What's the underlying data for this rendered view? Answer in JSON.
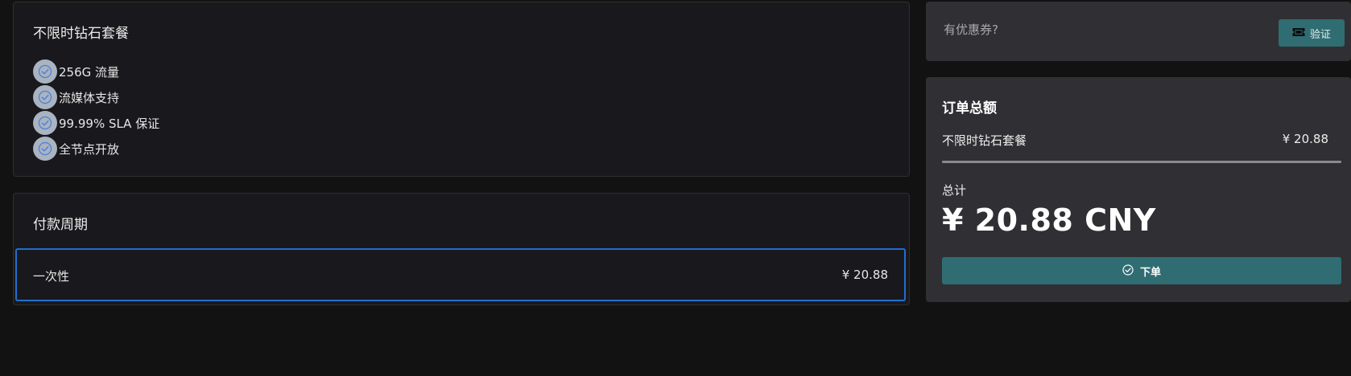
{
  "plan": {
    "title": "不限时钻石套餐",
    "features": [
      {
        "label": "256G 流量"
      },
      {
        "label": "流媒体支持"
      },
      {
        "label": "99.99% SLA 保证"
      },
      {
        "label": "全节点开放"
      }
    ]
  },
  "billing": {
    "title": "付款周期",
    "selected_option": {
      "label": "一次性",
      "price": "¥ 20.88"
    }
  },
  "coupon": {
    "placeholder": "有优惠券?",
    "value": "",
    "verify_label": "验证",
    "verify_icon": "ticket-icon"
  },
  "summary": {
    "title": "订单总额",
    "item_name": "不限时钻石套餐",
    "item_price": "¥ 20.88",
    "total_label": "总计",
    "total_amount": "¥ 20.88 CNY",
    "order_label": "下单",
    "order_icon": "check-circle-icon"
  },
  "colors": {
    "page_bg": "#121212",
    "card_bg": "#19191d",
    "side_card_bg": "#303034",
    "accent_button": "#2f6d72",
    "selected_border": "#1f6fd1",
    "check_badge": "#aab3c0",
    "check_mark": "#4a7fd6"
  }
}
